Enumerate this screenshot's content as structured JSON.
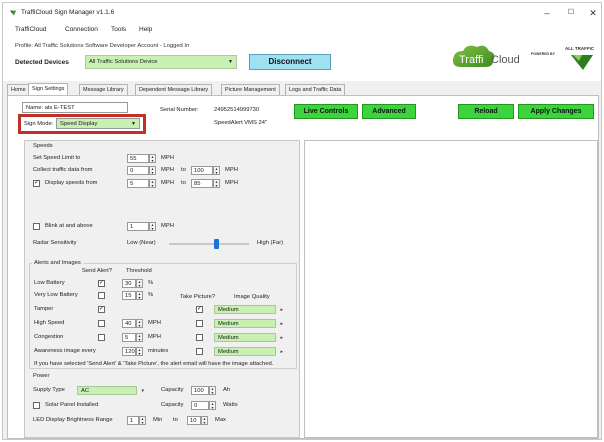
{
  "window": {
    "title": "TraffiCloud Sign Manager v1.1.6",
    "minimize": "–",
    "maximize": "☐",
    "close": "✕"
  },
  "menu": [
    "TraffiCloud",
    "Connection",
    "Tools",
    "Help"
  ],
  "header": {
    "profile": "Profile: All Traffic Solutions Software Developer Account - Logged In",
    "detected_label": "Detected Devices",
    "detected_value": "All Traffic Solutions Device",
    "disconnect": "Disconnect",
    "logo_text": "TraffiCloud",
    "powered_by": "POWERED BY",
    "ats_text": "ALL TRAFFIC"
  },
  "tabs": [
    "Home",
    "Sign Settings",
    "Message Library",
    "Dependent Message Library",
    "Picture Management",
    "Logs and Traffic Data"
  ],
  "active_tab": "Sign Settings",
  "sign": {
    "name_label": "Name:",
    "name_value": "ats E-TEST",
    "mode_label": "Sign Mode:",
    "mode_value": "Speed Display",
    "serial_label": "Serial Number:",
    "serial_value": "24952514999730",
    "model": "SpeedAlert VMS 24\""
  },
  "buttons": {
    "live_controls": "Live Controls",
    "advanced": "Advanced",
    "reload": "Reload",
    "apply": "Apply Changes"
  },
  "speeds": {
    "title": "Speeds",
    "limit_label": "Set Speed Limit to",
    "limit_value": "55",
    "unit": "MPH",
    "collect_label": "Collect traffic data from",
    "collect_from": "0",
    "collect_to": "100",
    "to": "to",
    "display_label": "Display speeds from",
    "display_checked": true,
    "display_from": "5",
    "display_to": "85",
    "blink_label": "Blink at and above",
    "blink_value": "1",
    "radar_label": "Radar Sensitivity",
    "radar_low": "Low (Near)",
    "radar_high": "High (Far)",
    "radar_level": 0.6
  },
  "alerts": {
    "title": "Alerts and Images",
    "send_alert_header": "Send Alert?",
    "threshold_header": "Threshold",
    "take_picture_header": "Take Picture?",
    "image_quality_header": "Image Quality",
    "rows": [
      {
        "label": "Low Battery",
        "send": true,
        "threshold": "30",
        "unit": "%"
      },
      {
        "label": "Very Low Battery",
        "send": false,
        "threshold": "15",
        "unit": "%"
      },
      {
        "label": "Tamper",
        "send": true,
        "threshold": "",
        "unit": "",
        "picture": true,
        "quality": "Medium"
      },
      {
        "label": "High Speed",
        "send": false,
        "threshold": "40",
        "unit": "MPH",
        "picture": false,
        "quality": "Medium"
      },
      {
        "label": "Congestion",
        "send": false,
        "threshold": "5",
        "unit": "MPH",
        "picture": false,
        "quality": "Medium"
      },
      {
        "label": "Awareness image every",
        "threshold": "120",
        "unit": "minutes",
        "picture": false,
        "quality": "Medium"
      }
    ],
    "note": "If you have selected 'Send Alert' & 'Take Picture', the alert email will have the image attached."
  },
  "power": {
    "title": "Power",
    "supply_label": "Supply Type",
    "supply_value": "AC",
    "capacity_label": "Capacity",
    "capacity_value": "100",
    "capacity_unit": "Ah",
    "solar_label": "Solar Panel Installed",
    "solar_checked": false,
    "solar_capacity": "0",
    "solar_unit": "Watts",
    "brightness_label": "LED Display Brightness Range",
    "brightness_min": "1",
    "min_label": "Min",
    "to": "to",
    "brightness_max": "10",
    "max_label": "Max"
  },
  "colors": {
    "accent_green": "#3cd43c",
    "select_green": "#c8f0b2",
    "disconnect_blue": "#9fe0f2",
    "highlight_red": "#c0312b"
  }
}
